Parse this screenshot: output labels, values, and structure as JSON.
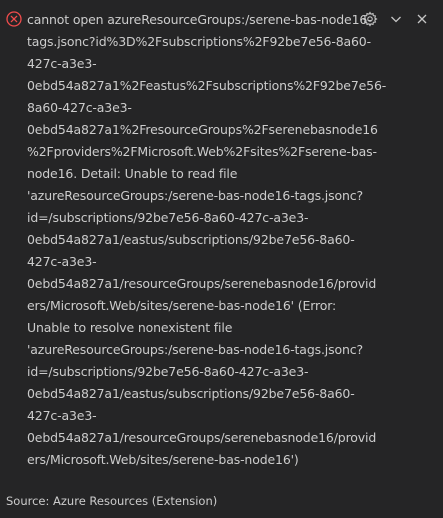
{
  "notification": {
    "severity": "error",
    "message_lines": [
      "cannot open azureResourceGroups:/serene-bas-node16-",
      "tags.jsonc?id%3D%2Fsubscriptions%2F92be7e56-8a60-",
      "427c-a3e3-",
      "0ebd54a827a1%2Feastus%2Fsubscriptions%2F92be7e56-",
      "8a60-427c-a3e3-",
      "0ebd54a827a1%2FresourceGroups%2Fserenebasnode16",
      "%2Fproviders%2FMicrosoft.Web%2Fsites%2Fserene-bas-",
      "node16. Detail: Unable to read file",
      "'azureResourceGroups:/serene-bas-node16-tags.jsonc?",
      "id=/subscriptions/92be7e56-8a60-427c-a3e3-",
      "0ebd54a827a1/eastus/subscriptions/92be7e56-8a60-",
      "427c-a3e3-",
      "0ebd54a827a1/resourceGroups/serenebasnode16/provid",
      "ers/Microsoft.Web/sites/serene-bas-node16' (Error:",
      "Unable to resolve nonexistent file",
      "'azureResourceGroups:/serene-bas-node16-tags.jsonc?",
      "id=/subscriptions/92be7e56-8a60-427c-a3e3-",
      "0ebd54a827a1/eastus/subscriptions/92be7e56-8a60-",
      "427c-a3e3-",
      "0ebd54a827a1/resourceGroups/serenebasnode16/provid",
      "ers/Microsoft.Web/sites/serene-bas-node16')"
    ],
    "source": "Source: Azure Resources (Extension)",
    "actions": {
      "settings_icon": "gear-icon",
      "collapse_icon": "chevron-down-icon",
      "close_icon": "close-icon"
    }
  },
  "colors": {
    "background": "#252526",
    "text": "#cccccc",
    "error": "#f14c4c"
  }
}
